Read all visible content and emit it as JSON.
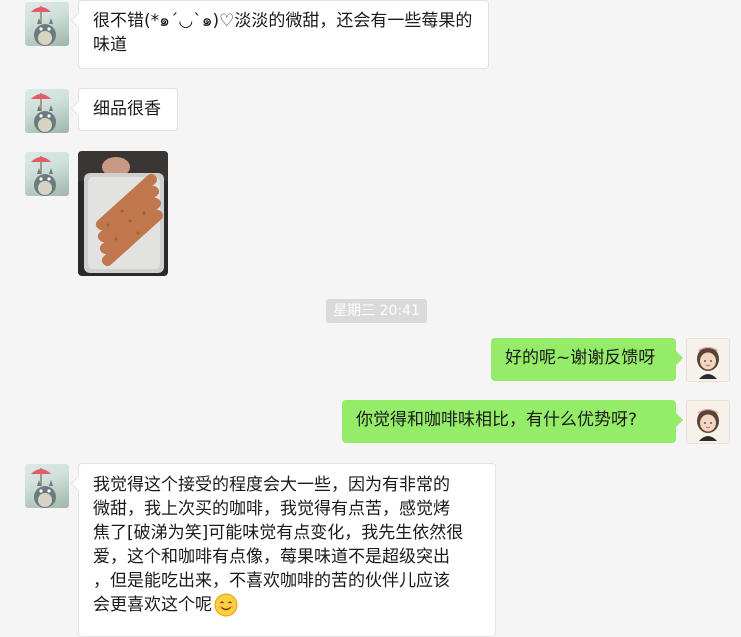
{
  "messages": [
    {
      "id": "m1",
      "side": "left",
      "type": "text",
      "lines": [
        "很不错(*๑´◡`๑)♡淡淡的微甜，还会有一些莓果的",
        "味道"
      ]
    },
    {
      "id": "m2",
      "side": "left",
      "type": "text",
      "lines": [
        "细品很香"
      ]
    },
    {
      "id": "m3",
      "side": "left",
      "type": "image",
      "subject": "crispy-biscuit-sticks"
    },
    {
      "id": "m4",
      "side": "right",
      "type": "text",
      "lines": [
        "好的呢~谢谢反馈呀"
      ]
    },
    {
      "id": "m5",
      "side": "right",
      "type": "text",
      "lines": [
        "你觉得和咖啡味相比，有什么优势呀?"
      ]
    },
    {
      "id": "m6",
      "side": "left",
      "type": "text",
      "lines": [
        "我觉得这个接受的程度会大一些，因为有非常的",
        "微甜，我上次买的咖啡，我觉得有点苦，感觉烤",
        "焦了[破涕为笑]可能味觉有点变化，我先生依然很",
        "爱，这个和咖啡有点像，莓果味道不是超级突出",
        "，但是能吃出来，不喜欢咖啡的苦的伙伴儿应该",
        "会更喜欢这个呢"
      ],
      "trailing_emoji": "smile-emoji-icon"
    }
  ],
  "timestamp": "星期三 20:41",
  "colors": {
    "background": "#f5f5f5",
    "self_bubble": "#95ec69",
    "other_bubble": "#ffffff",
    "timestamp_bg": "#dadada"
  },
  "avatars": {
    "other": "totoro-avatar-icon",
    "self": "girl-avatar-icon"
  }
}
